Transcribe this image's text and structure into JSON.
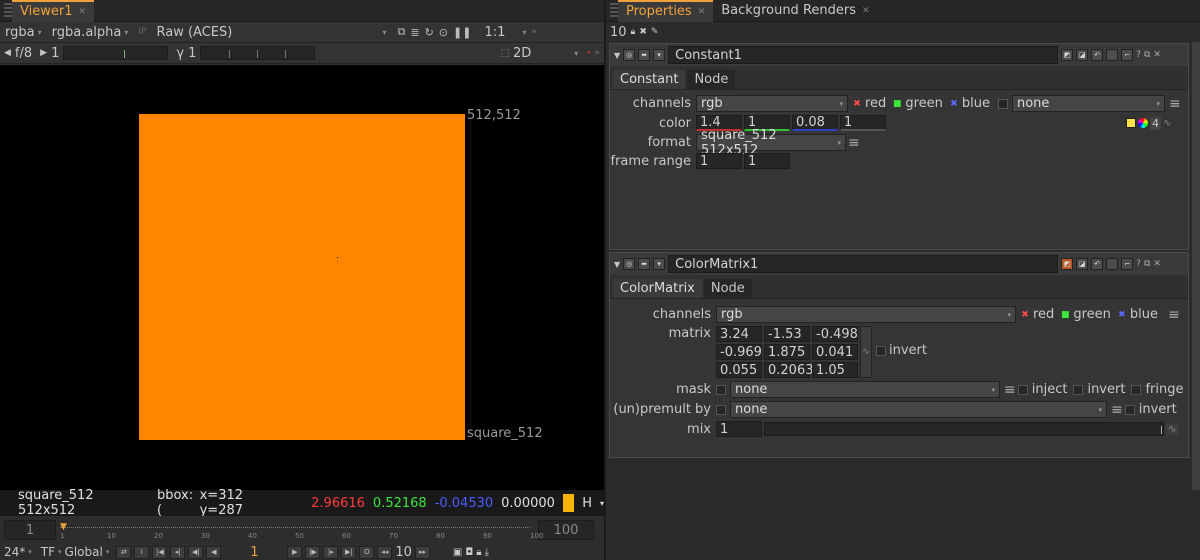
{
  "viewer": {
    "tab": "Viewer1",
    "channels": "rgba",
    "alpha": "rgba.alpha",
    "ip": "IP",
    "colorspace": "Raw (ACES)",
    "zoom": "1:1",
    "fstop": "f/8",
    "gain": "1",
    "gamma_symbol": "γ",
    "gamma": "1",
    "view_mode": "2D",
    "format_top": "512,512",
    "format_bottom": "square_512",
    "swatch_color": "#ff8500"
  },
  "infobar": {
    "format": "square_512 512x512",
    "bbox": "bbox: (",
    "coords": "x=312 y=287",
    "r": "2.96616",
    "g": "0.52168",
    "b": "-0.04530",
    "a": "0.00000",
    "h": "H",
    "sample_color": "#f5b400"
  },
  "timeline": {
    "in": "1",
    "out": "100",
    "ticks": [
      "1",
      "10",
      "20",
      "30",
      "40",
      "50",
      "60",
      "70",
      "80",
      "90",
      "100"
    ]
  },
  "playbar": {
    "fps": "24*",
    "tf": "TF",
    "global": "Global",
    "frame": "1",
    "step": "10"
  },
  "properties": {
    "tab1": "Properties",
    "tab2": "Background Renders",
    "max_panels": "10"
  },
  "constant": {
    "name": "Constant1",
    "tabs": [
      "Constant",
      "Node"
    ],
    "channels_label": "channels",
    "channels": "rgb",
    "red": "red",
    "green": "green",
    "blue": "blue",
    "none": "none",
    "color_label": "color",
    "color_values": [
      "1.4",
      "1",
      "0.08",
      "1"
    ],
    "color_count": "4",
    "format_label": "format",
    "format": "square_512 512x512",
    "frame_range_label": "frame range",
    "frame_range": [
      "1",
      "1"
    ]
  },
  "colormatrix": {
    "name": "ColorMatrix1",
    "tabs": [
      "ColorMatrix",
      "Node"
    ],
    "channels_label": "channels",
    "channels": "rgb",
    "red": "red",
    "green": "green",
    "blue": "blue",
    "matrix_label": "matrix",
    "matrix": [
      [
        "3.24",
        "-1.53",
        "-0.498"
      ],
      [
        "-0.969",
        "1.875",
        "0.041"
      ],
      [
        "0.055",
        "0.2063",
        "1.05"
      ]
    ],
    "invert": "invert",
    "mask_label": "mask",
    "mask": "none",
    "inject": "inject",
    "mask_invert": "invert",
    "fringe": "fringe",
    "premult_label": "(un)premult by",
    "premult": "none",
    "premult_invert": "invert",
    "mix_label": "mix",
    "mix": "1"
  },
  "colors": {
    "accent": "#f0a23a",
    "red_text": "#ff3b3b",
    "green_text": "#3ce63c",
    "blue_text": "#4a5dff"
  }
}
